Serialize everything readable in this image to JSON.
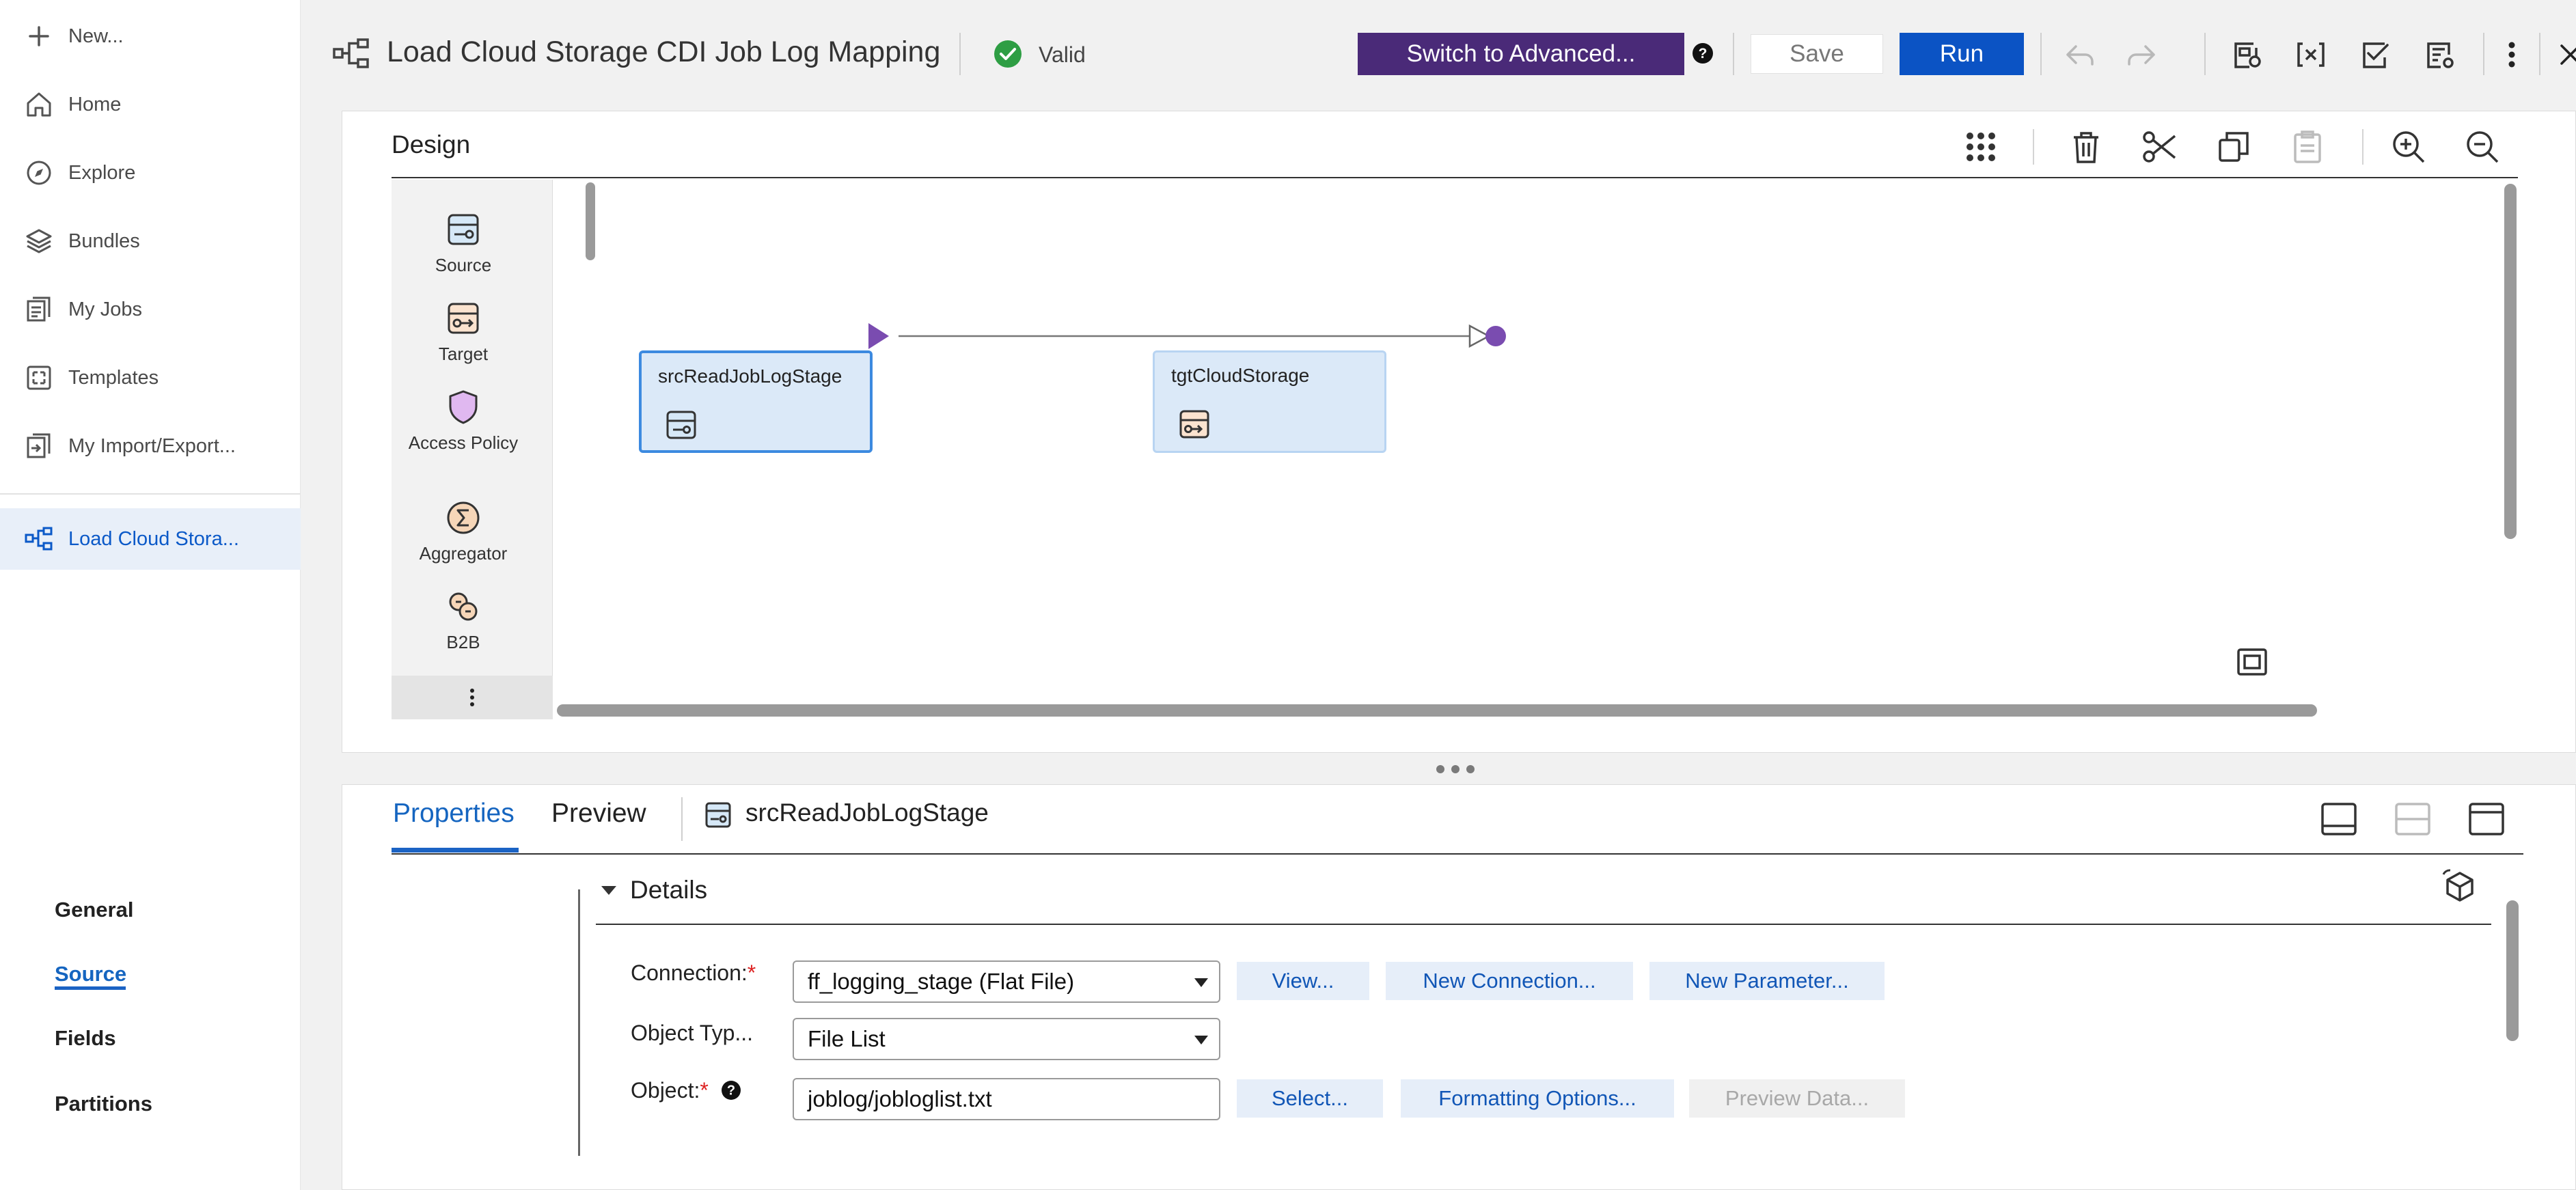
{
  "nav": {
    "new_label": "New...",
    "items": [
      {
        "label": "Home",
        "icon": "home-icon"
      },
      {
        "label": "Explore",
        "icon": "compass-icon"
      },
      {
        "label": "Bundles",
        "icon": "layers-icon"
      },
      {
        "label": "My Jobs",
        "icon": "jobs-icon"
      },
      {
        "label": "Templates",
        "icon": "templates-icon"
      },
      {
        "label": "My Import/Export..."
      }
    ],
    "active_item": "Load Cloud Stora..."
  },
  "header": {
    "title": "Load Cloud Storage CDI Job Log Mapping",
    "status": "Valid",
    "status_color": "#2e9e44",
    "advanced_label": "Switch to Advanced...",
    "save_label": "Save",
    "run_label": "Run"
  },
  "design": {
    "title": "Design",
    "palette": [
      {
        "label": "Source",
        "icon": "source-icon"
      },
      {
        "label": "Target",
        "icon": "target-icon"
      },
      {
        "label": "Access Policy",
        "icon": "shield-icon"
      },
      {
        "label": "Aggregator",
        "icon": "sigma-icon"
      },
      {
        "label": "B2B",
        "icon": "b2b-icon"
      }
    ],
    "nodes": [
      {
        "label": "srcReadJobLogStage",
        "role": "source"
      },
      {
        "label": "tgtCloudStorage",
        "role": "target"
      }
    ],
    "accent": "#7a4cb0"
  },
  "properties": {
    "tabs": [
      "Properties",
      "Preview"
    ],
    "active_tab": "Properties",
    "selected_node": "srcReadJobLogStage",
    "side_tabs": [
      "General",
      "Source",
      "Fields",
      "Partitions"
    ],
    "active_side_tab": "Source",
    "details_label": "Details",
    "connection": {
      "label": "Connection:",
      "required": "*",
      "value": "ff_logging_stage (Flat File)",
      "view_label": "View...",
      "new_connection_label": "New Connection...",
      "new_parameter_label": "New Parameter..."
    },
    "object_type": {
      "label": "Object Typ...",
      "value": "File List"
    },
    "object": {
      "label": "Object:",
      "required": "*",
      "value": "joblog/jobloglist.txt",
      "select_label": "Select...",
      "formatting_label": "Formatting Options...",
      "preview_label": "Preview Data..."
    }
  }
}
